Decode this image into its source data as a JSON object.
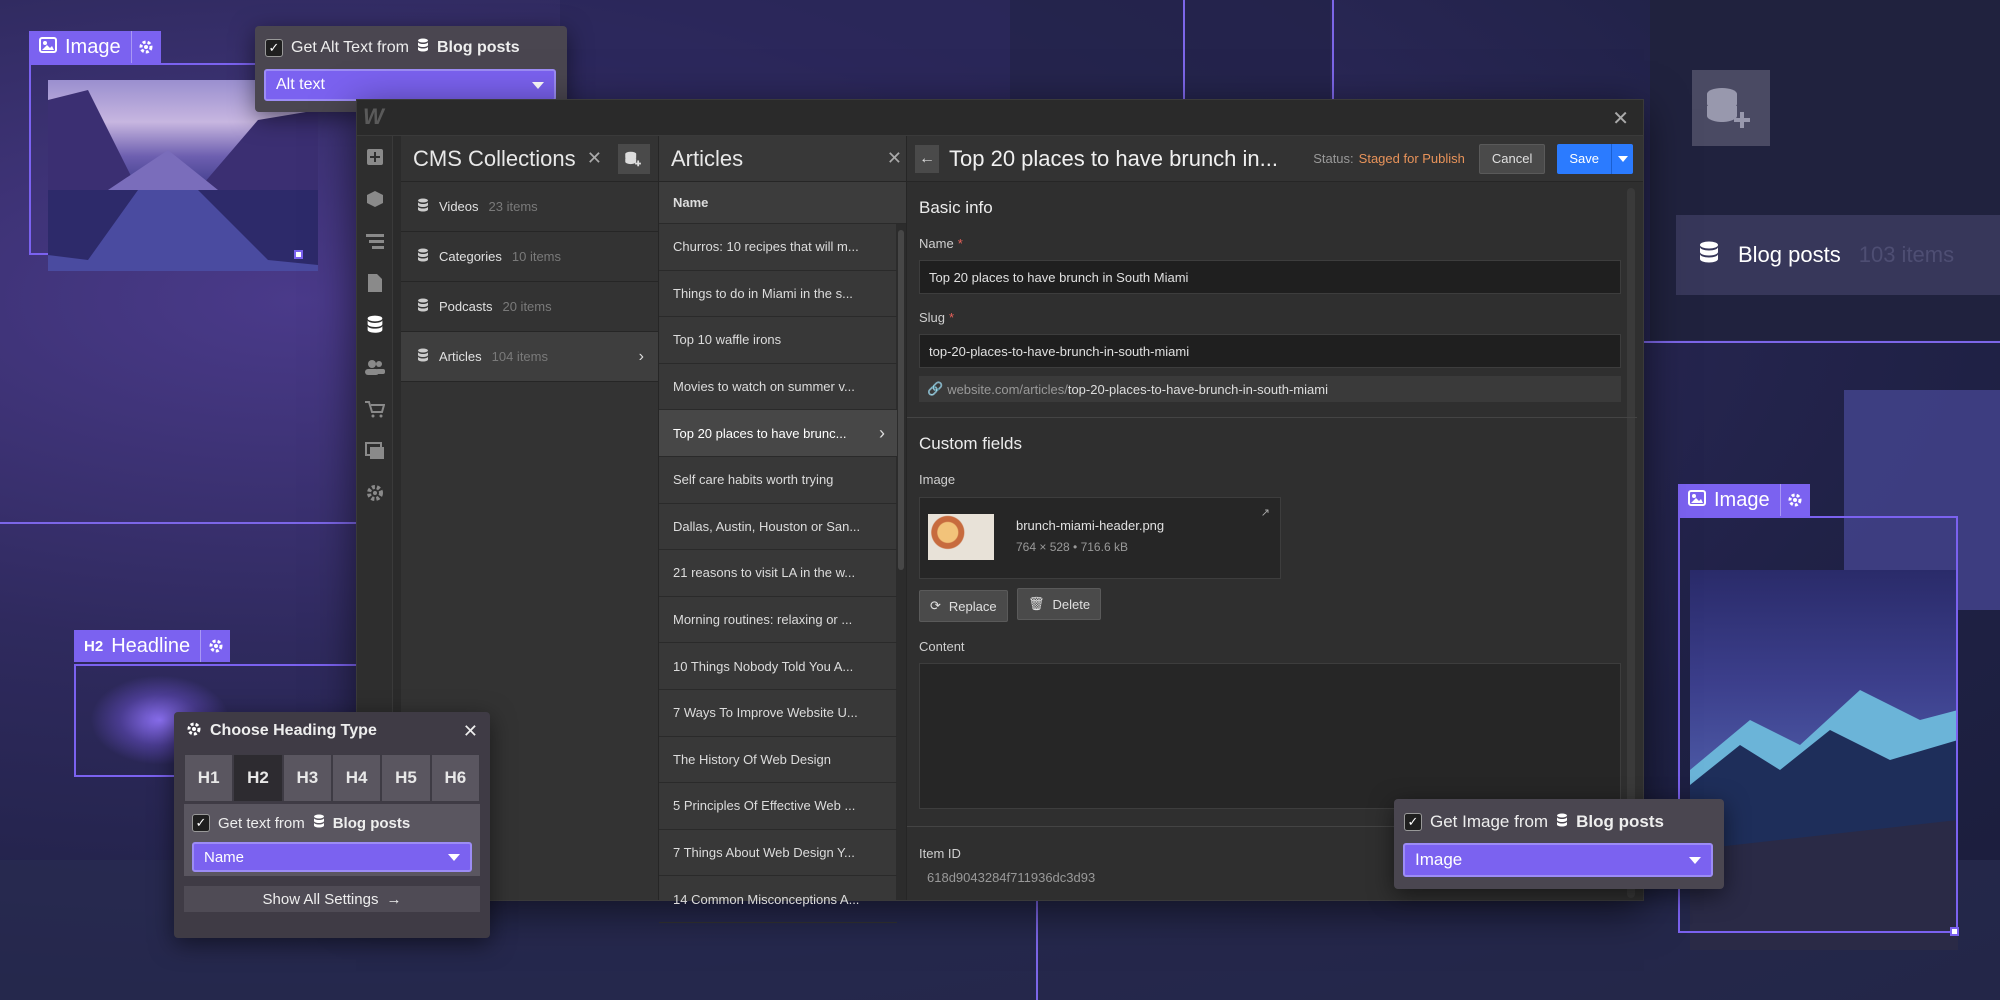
{
  "image_tag_top": {
    "label": "Image"
  },
  "alt_popover": {
    "checkbox_label": "Get Alt Text from",
    "source": "Blog posts",
    "dropdown_value": "Alt text"
  },
  "window": {
    "collections": {
      "title": "CMS Collections",
      "items": [
        {
          "name": "Videos",
          "count": "23 items"
        },
        {
          "name": "Categories",
          "count": "10 items"
        },
        {
          "name": "Podcasts",
          "count": "20 items"
        },
        {
          "name": "Articles",
          "count": "104 items"
        }
      ]
    },
    "articles": {
      "title": "Articles",
      "column_header": "Name",
      "rows": [
        "Churros: 10 recipes that will m...",
        "Things to do in Miami in the s...",
        "Top 10 waffle irons",
        "Movies to watch on summer v...",
        "Top 20 places to have brunc...",
        "Self care habits worth trying",
        "Dallas, Austin, Houston or San...",
        "21 reasons to visit LA in the w...",
        "Morning routines: relaxing or ...",
        "10 Things Nobody Told You A...",
        "7 Ways To Improve Website U...",
        "The History Of Web Design",
        "5 Principles Of Effective Web ...",
        "7 Things About Web Design Y...",
        "14 Common Misconceptions A..."
      ]
    },
    "editor": {
      "title": "Top 20 places to have brunch in...",
      "status_label": "Status:",
      "status_value": "Staged for Publish",
      "cancel_label": "Cancel",
      "save_label": "Save",
      "basic_info_title": "Basic info",
      "name_label": "Name",
      "name_value": "Top 20 places to have brunch in South Miami",
      "slug_label": "Slug",
      "slug_value": "top-20-places-to-have-brunch-in-south-miami",
      "url_prefix": "website.com/articles/",
      "url_slug": "top-20-places-to-have-brunch-in-south-miami",
      "custom_fields_title": "Custom fields",
      "image_label": "Image",
      "file_name": "brunch-miami-header.png",
      "file_meta": "764 × 528 • 716.6 kB",
      "replace_label": "Replace",
      "delete_label": "Delete",
      "content_label": "Content",
      "item_id_label": "Item ID",
      "item_id_value": "618d9043284f711936dc3d93"
    }
  },
  "blog_posts_card": {
    "name": "Blog posts",
    "count": "103 items"
  },
  "image_tag_right": {
    "label": "Image"
  },
  "image_popover": {
    "checkbox_label": "Get Image from",
    "source": "Blog posts",
    "dropdown_value": "Image"
  },
  "headline_tag": {
    "badge": "H2",
    "label": "Headline"
  },
  "heading_popover": {
    "title": "Choose Heading Type",
    "levels": [
      "H1",
      "H2",
      "H3",
      "H4",
      "H5",
      "H6"
    ],
    "selected": "H2",
    "checkbox_label": "Get text from",
    "source": "Blog posts",
    "dropdown_value": "Name",
    "show_all_label": "Show All Settings"
  },
  "colors": {
    "accent": "#7b62f0",
    "save_blue": "#2b7bff",
    "status_orange": "#e8935a"
  }
}
